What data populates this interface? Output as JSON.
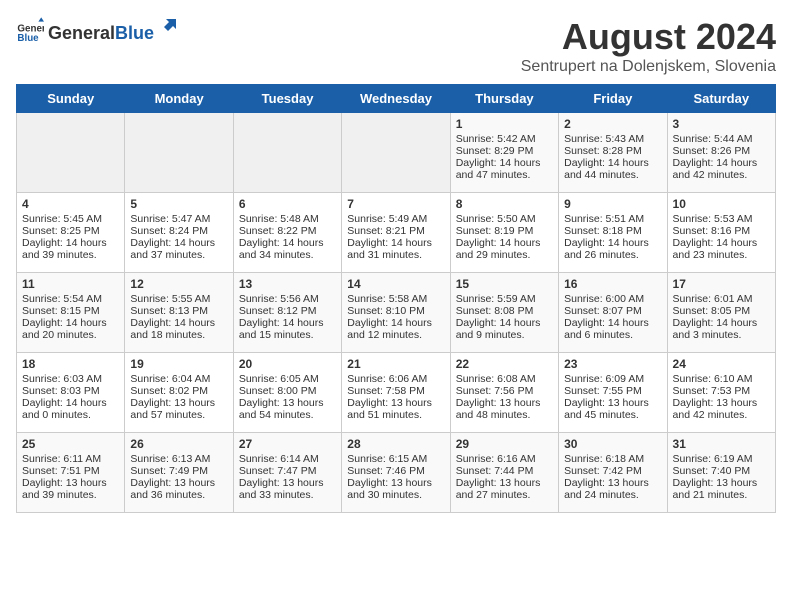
{
  "header": {
    "logo_general": "General",
    "logo_blue": "Blue",
    "main_title": "August 2024",
    "subtitle": "Sentrupert na Dolenjskem, Slovenia"
  },
  "days_of_week": [
    "Sunday",
    "Monday",
    "Tuesday",
    "Wednesday",
    "Thursday",
    "Friday",
    "Saturday"
  ],
  "weeks": [
    [
      {
        "day": "",
        "content": ""
      },
      {
        "day": "",
        "content": ""
      },
      {
        "day": "",
        "content": ""
      },
      {
        "day": "",
        "content": ""
      },
      {
        "day": "1",
        "content": "Sunrise: 5:42 AM\nSunset: 8:29 PM\nDaylight: 14 hours and 47 minutes."
      },
      {
        "day": "2",
        "content": "Sunrise: 5:43 AM\nSunset: 8:28 PM\nDaylight: 14 hours and 44 minutes."
      },
      {
        "day": "3",
        "content": "Sunrise: 5:44 AM\nSunset: 8:26 PM\nDaylight: 14 hours and 42 minutes."
      }
    ],
    [
      {
        "day": "4",
        "content": "Sunrise: 5:45 AM\nSunset: 8:25 PM\nDaylight: 14 hours and 39 minutes."
      },
      {
        "day": "5",
        "content": "Sunrise: 5:47 AM\nSunset: 8:24 PM\nDaylight: 14 hours and 37 minutes."
      },
      {
        "day": "6",
        "content": "Sunrise: 5:48 AM\nSunset: 8:22 PM\nDaylight: 14 hours and 34 minutes."
      },
      {
        "day": "7",
        "content": "Sunrise: 5:49 AM\nSunset: 8:21 PM\nDaylight: 14 hours and 31 minutes."
      },
      {
        "day": "8",
        "content": "Sunrise: 5:50 AM\nSunset: 8:19 PM\nDaylight: 14 hours and 29 minutes."
      },
      {
        "day": "9",
        "content": "Sunrise: 5:51 AM\nSunset: 8:18 PM\nDaylight: 14 hours and 26 minutes."
      },
      {
        "day": "10",
        "content": "Sunrise: 5:53 AM\nSunset: 8:16 PM\nDaylight: 14 hours and 23 minutes."
      }
    ],
    [
      {
        "day": "11",
        "content": "Sunrise: 5:54 AM\nSunset: 8:15 PM\nDaylight: 14 hours and 20 minutes."
      },
      {
        "day": "12",
        "content": "Sunrise: 5:55 AM\nSunset: 8:13 PM\nDaylight: 14 hours and 18 minutes."
      },
      {
        "day": "13",
        "content": "Sunrise: 5:56 AM\nSunset: 8:12 PM\nDaylight: 14 hours and 15 minutes."
      },
      {
        "day": "14",
        "content": "Sunrise: 5:58 AM\nSunset: 8:10 PM\nDaylight: 14 hours and 12 minutes."
      },
      {
        "day": "15",
        "content": "Sunrise: 5:59 AM\nSunset: 8:08 PM\nDaylight: 14 hours and 9 minutes."
      },
      {
        "day": "16",
        "content": "Sunrise: 6:00 AM\nSunset: 8:07 PM\nDaylight: 14 hours and 6 minutes."
      },
      {
        "day": "17",
        "content": "Sunrise: 6:01 AM\nSunset: 8:05 PM\nDaylight: 14 hours and 3 minutes."
      }
    ],
    [
      {
        "day": "18",
        "content": "Sunrise: 6:03 AM\nSunset: 8:03 PM\nDaylight: 14 hours and 0 minutes."
      },
      {
        "day": "19",
        "content": "Sunrise: 6:04 AM\nSunset: 8:02 PM\nDaylight: 13 hours and 57 minutes."
      },
      {
        "day": "20",
        "content": "Sunrise: 6:05 AM\nSunset: 8:00 PM\nDaylight: 13 hours and 54 minutes."
      },
      {
        "day": "21",
        "content": "Sunrise: 6:06 AM\nSunset: 7:58 PM\nDaylight: 13 hours and 51 minutes."
      },
      {
        "day": "22",
        "content": "Sunrise: 6:08 AM\nSunset: 7:56 PM\nDaylight: 13 hours and 48 minutes."
      },
      {
        "day": "23",
        "content": "Sunrise: 6:09 AM\nSunset: 7:55 PM\nDaylight: 13 hours and 45 minutes."
      },
      {
        "day": "24",
        "content": "Sunrise: 6:10 AM\nSunset: 7:53 PM\nDaylight: 13 hours and 42 minutes."
      }
    ],
    [
      {
        "day": "25",
        "content": "Sunrise: 6:11 AM\nSunset: 7:51 PM\nDaylight: 13 hours and 39 minutes."
      },
      {
        "day": "26",
        "content": "Sunrise: 6:13 AM\nSunset: 7:49 PM\nDaylight: 13 hours and 36 minutes."
      },
      {
        "day": "27",
        "content": "Sunrise: 6:14 AM\nSunset: 7:47 PM\nDaylight: 13 hours and 33 minutes."
      },
      {
        "day": "28",
        "content": "Sunrise: 6:15 AM\nSunset: 7:46 PM\nDaylight: 13 hours and 30 minutes."
      },
      {
        "day": "29",
        "content": "Sunrise: 6:16 AM\nSunset: 7:44 PM\nDaylight: 13 hours and 27 minutes."
      },
      {
        "day": "30",
        "content": "Sunrise: 6:18 AM\nSunset: 7:42 PM\nDaylight: 13 hours and 24 minutes."
      },
      {
        "day": "31",
        "content": "Sunrise: 6:19 AM\nSunset: 7:40 PM\nDaylight: 13 hours and 21 minutes."
      }
    ]
  ]
}
